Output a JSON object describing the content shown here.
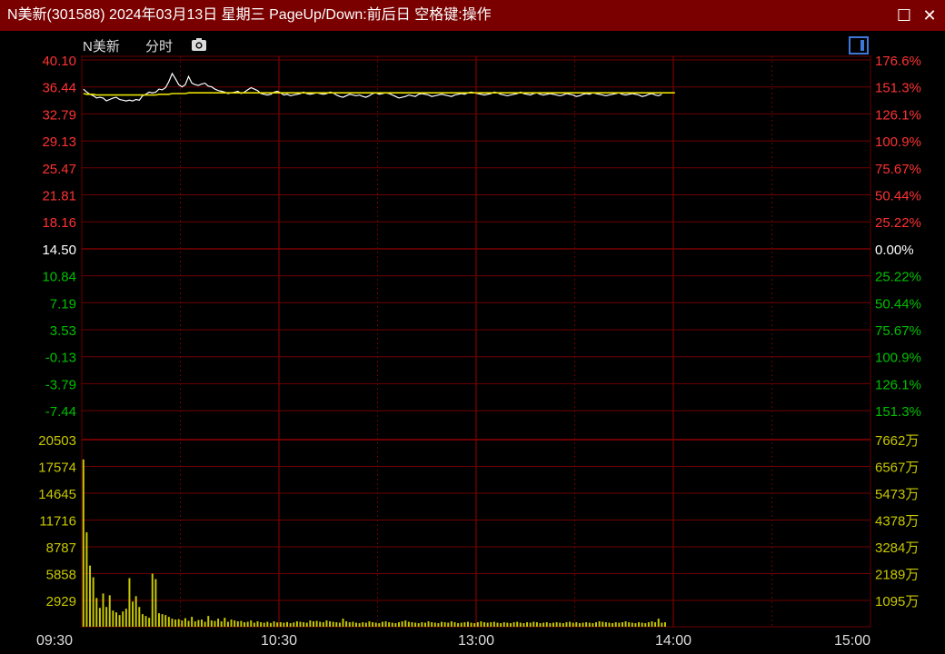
{
  "window": {
    "title": "N美新(301588) 2024年03月13日 星期三 PageUp/Down:前后日 空格键:操作",
    "maximize_glyph": "☐",
    "close_glyph": "✕"
  },
  "header": {
    "stock_name": "N美新",
    "view_label": "分时",
    "camera_icon": "camera-icon",
    "panel_icon": "panel-toggle-icon"
  },
  "colors": {
    "grid": "#6e0000",
    "up": "#ff3232",
    "down": "#00c000",
    "neutral": "#ffffff",
    "volume": "#c8c800",
    "price_line": "#ffffff",
    "avg_line": "#e8e000"
  },
  "chart_data": {
    "type": "line",
    "title": "",
    "xlabel": "",
    "ylabel": "",
    "x_ticks": [
      "09:30",
      "10:30",
      "13:00",
      "14:00",
      "15:00"
    ],
    "price": {
      "prev_close": 14.5,
      "ylim": [
        -9.27,
        41.93
      ],
      "left_ticks": [
        "40.10",
        "36.44",
        "32.79",
        "29.13",
        "25.47",
        "21.81",
        "18.16",
        "14.50",
        "10.84",
        "7.19",
        "3.53",
        "-0.13",
        "-3.79",
        "-7.44"
      ],
      "right_ticks": [
        "176.6%",
        "151.3%",
        "126.1%",
        "100.9%",
        "75.67%",
        "50.44%",
        "25.22%",
        "0.00%",
        "25.22%",
        "50.44%",
        "75.67%",
        "100.9%",
        "126.1%",
        "151.3%"
      ],
      "series": [
        {
          "name": "",
          "role": "price",
          "values": [
            38.0,
            37.6,
            37.3,
            37.1,
            36.8,
            36.9,
            36.8,
            36.4,
            36.6,
            36.8,
            36.9,
            36.6,
            36.5,
            36.4,
            36.5,
            36.4,
            36.6,
            36.5,
            37.1,
            37.3,
            37.6,
            37.5,
            37.6,
            38.0,
            37.9,
            38.2,
            39.0,
            40.1,
            39.4,
            38.6,
            38.3,
            38.6,
            39.7,
            38.8,
            38.6,
            38.5,
            38.7,
            38.8,
            38.4,
            38.3,
            38.0,
            37.8,
            37.7,
            37.6,
            37.4,
            37.5,
            37.6,
            37.7,
            37.4,
            37.6,
            37.9,
            38.2,
            38.0,
            37.8,
            37.4,
            37.3,
            37.2,
            37.3,
            37.6,
            37.7,
            37.5,
            37.2,
            37.3,
            37.1,
            37.2,
            37.3,
            37.4,
            37.6,
            37.4,
            37.3,
            37.4,
            37.5,
            37.4,
            37.3,
            37.4,
            37.6,
            37.5,
            37.2,
            37.0,
            36.9,
            37.1,
            37.3,
            37.2,
            37.1,
            37.2,
            37.0,
            36.9,
            37.1,
            37.4,
            37.5,
            37.3,
            37.4,
            37.5,
            37.4,
            37.2,
            37.0,
            36.8,
            36.9,
            37.0,
            37.2,
            37.1,
            37.0,
            37.3,
            37.4,
            37.3,
            37.2,
            37.0,
            37.1,
            37.2,
            37.3,
            37.2,
            37.1,
            37.0,
            37.2,
            37.3,
            37.4,
            37.3,
            37.5,
            37.6,
            37.5,
            37.4,
            37.3,
            37.2,
            37.3,
            37.4,
            37.6,
            37.5,
            37.3,
            37.2,
            37.1,
            37.2,
            37.3,
            37.4,
            37.6,
            37.4,
            37.3,
            37.2,
            37.4,
            37.5,
            37.3,
            37.2,
            37.3,
            37.4,
            37.3,
            37.2,
            37.1,
            37.2,
            37.4,
            37.3,
            37.2,
            37.0,
            37.1,
            37.3,
            37.4,
            37.3,
            37.5,
            37.4,
            37.3,
            37.2,
            37.1,
            37.2,
            37.3,
            37.4,
            37.5,
            37.3,
            37.2,
            37.3,
            37.4,
            37.3,
            37.2,
            37.0,
            37.1,
            37.3,
            37.4,
            37.2,
            37.1,
            37.3
          ]
        },
        {
          "name": "",
          "role": "average",
          "values": [
            37.4,
            37.3,
            37.3,
            37.3,
            37.2,
            37.2,
            37.2,
            37.2,
            37.2,
            37.2,
            37.2,
            37.2,
            37.2,
            37.2,
            37.2,
            37.2,
            37.2,
            37.2,
            37.2,
            37.2,
            37.2,
            37.2,
            37.2,
            37.3,
            37.3,
            37.3,
            37.3,
            37.4,
            37.4,
            37.4,
            37.4,
            37.4,
            37.5,
            37.5,
            37.5,
            37.5,
            37.5,
            37.5,
            37.5,
            37.5,
            37.5,
            37.5,
            37.5,
            37.5,
            37.5,
            37.5,
            37.5,
            37.5,
            37.5,
            37.5,
            37.5,
            37.5,
            37.5,
            37.5,
            37.5,
            37.5,
            37.5,
            37.5,
            37.5,
            37.5,
            37.5,
            37.5,
            37.5,
            37.5,
            37.5,
            37.5,
            37.5,
            37.5,
            37.5,
            37.5,
            37.5,
            37.5,
            37.5,
            37.5,
            37.5,
            37.5,
            37.5,
            37.5,
            37.5,
            37.5,
            37.5,
            37.5,
            37.5,
            37.5,
            37.5,
            37.5,
            37.5,
            37.5,
            37.5,
            37.5,
            37.5,
            37.5,
            37.5,
            37.5,
            37.5,
            37.5,
            37.5,
            37.5,
            37.5,
            37.5,
            37.5,
            37.5,
            37.5,
            37.5,
            37.5,
            37.5,
            37.5,
            37.5,
            37.5,
            37.5,
            37.5,
            37.5,
            37.5,
            37.5,
            37.5,
            37.5,
            37.5,
            37.5,
            37.5,
            37.5,
            37.5,
            37.5,
            37.5,
            37.5,
            37.5,
            37.5,
            37.5,
            37.5,
            37.5,
            37.5,
            37.5,
            37.5,
            37.5,
            37.5,
            37.5,
            37.5,
            37.5,
            37.5,
            37.5,
            37.5,
            37.5,
            37.5,
            37.5,
            37.5,
            37.5,
            37.5,
            37.5,
            37.5,
            37.5,
            37.5,
            37.5,
            37.5,
            37.5,
            37.5,
            37.5,
            37.5,
            37.5,
            37.5,
            37.5,
            37.5,
            37.5,
            37.5,
            37.5,
            37.5,
            37.5,
            37.5,
            37.5,
            37.5,
            37.5,
            37.5,
            37.5,
            37.5,
            37.5,
            37.5,
            37.5,
            37.5,
            37.5,
            37.5,
            37.5,
            37.5,
            37.5
          ]
        }
      ]
    },
    "volume": {
      "type": "bar",
      "ylim": [
        0,
        20503
      ],
      "left_ticks": [
        "20503",
        "17574",
        "14645",
        "11716",
        "8787",
        "5858",
        "2929"
      ],
      "right_ticks": [
        "7662万",
        "6567万",
        "5473万",
        "4378万",
        "3284万",
        "2189万",
        "1095万"
      ],
      "values": [
        18600,
        10500,
        6800,
        5500,
        3200,
        2100,
        3700,
        2200,
        3500,
        1800,
        1600,
        1300,
        1700,
        2000,
        5400,
        2800,
        3400,
        2200,
        1400,
        1200,
        1000,
        5900,
        5300,
        1500,
        1400,
        1300,
        1100,
        900,
        800,
        850,
        700,
        950,
        650,
        1100,
        600,
        750,
        800,
        550,
        1200,
        700,
        650,
        900,
        600,
        1000,
        550,
        800,
        700,
        600,
        650,
        500,
        550,
        700,
        450,
        600,
        500,
        450,
        550,
        420,
        600,
        480,
        500,
        450,
        520,
        400,
        480,
        600,
        550,
        500,
        450,
        700,
        600,
        650,
        550,
        500,
        700,
        600,
        550,
        500,
        450,
        900,
        600,
        500,
        550,
        450,
        400,
        500,
        450,
        600,
        500,
        450,
        400,
        550,
        600,
        500,
        450,
        400,
        500,
        600,
        700,
        550,
        500,
        450,
        400,
        500,
        450,
        600,
        500,
        450,
        400,
        550,
        500,
        450,
        600,
        500,
        400,
        450,
        500,
        550,
        450,
        400,
        500,
        600,
        500,
        450,
        500,
        550,
        450,
        400,
        500,
        450,
        400,
        500,
        550,
        450,
        400,
        500,
        450,
        550,
        500,
        400,
        450,
        500,
        400,
        450,
        500,
        450,
        400,
        500,
        550,
        450,
        500,
        400,
        450,
        500,
        450,
        400,
        500,
        600,
        550,
        500,
        450,
        400,
        500,
        450,
        500,
        600,
        500,
        450,
        400,
        500,
        450,
        400,
        500,
        600,
        500,
        900,
        450,
        500
      ]
    },
    "total_minutes": 240,
    "grid": true,
    "legend": "none"
  }
}
